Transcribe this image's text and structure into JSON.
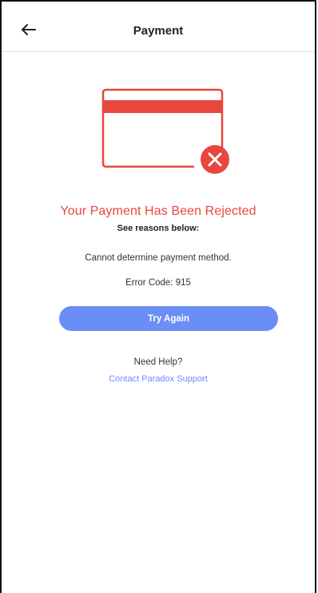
{
  "header": {
    "title": "Payment",
    "back_icon": "back-arrow-icon"
  },
  "illustration": {
    "icon": "rejected-card-icon",
    "accent_color": "#e8473e"
  },
  "status": {
    "title": "Your Payment Has Been Rejected",
    "subtitle": "See reasons below:",
    "reason": "Cannot determine payment method.",
    "error_code": "Error Code: 915"
  },
  "actions": {
    "try_again_label": "Try Again",
    "button_color": "#6b8ef6"
  },
  "help": {
    "question": "Need Help?",
    "link_label": "Contact Paradox Support"
  }
}
